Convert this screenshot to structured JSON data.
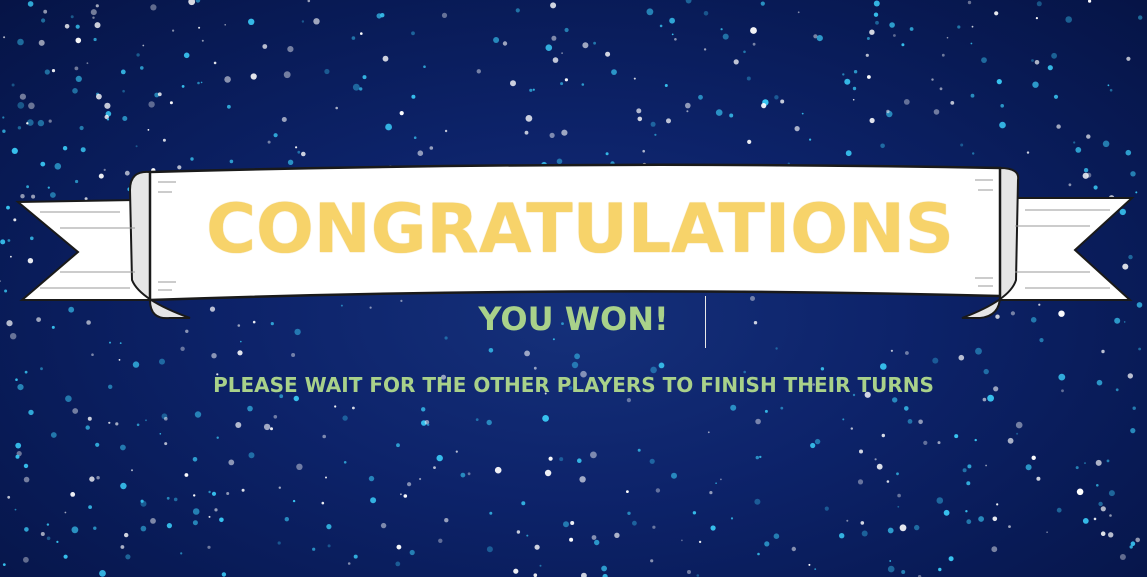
{
  "screen": {
    "title": "CONGRATULATIONS",
    "result": "YOU WON!",
    "message": "PLEASE WAIT FOR THE OTHER PLAYERS TO FINISH THEIR TURNS"
  },
  "colors": {
    "background": "#0d236a",
    "title_text": "#f7d36a",
    "message_text": "#a9d18a",
    "ribbon": "#ffffff",
    "sparkle_blue": "#38c3f0",
    "sparkle_white": "#ffffff"
  },
  "icons": {
    "ribbon": "scroll-banner-icon",
    "background": "sparkle-particles"
  }
}
